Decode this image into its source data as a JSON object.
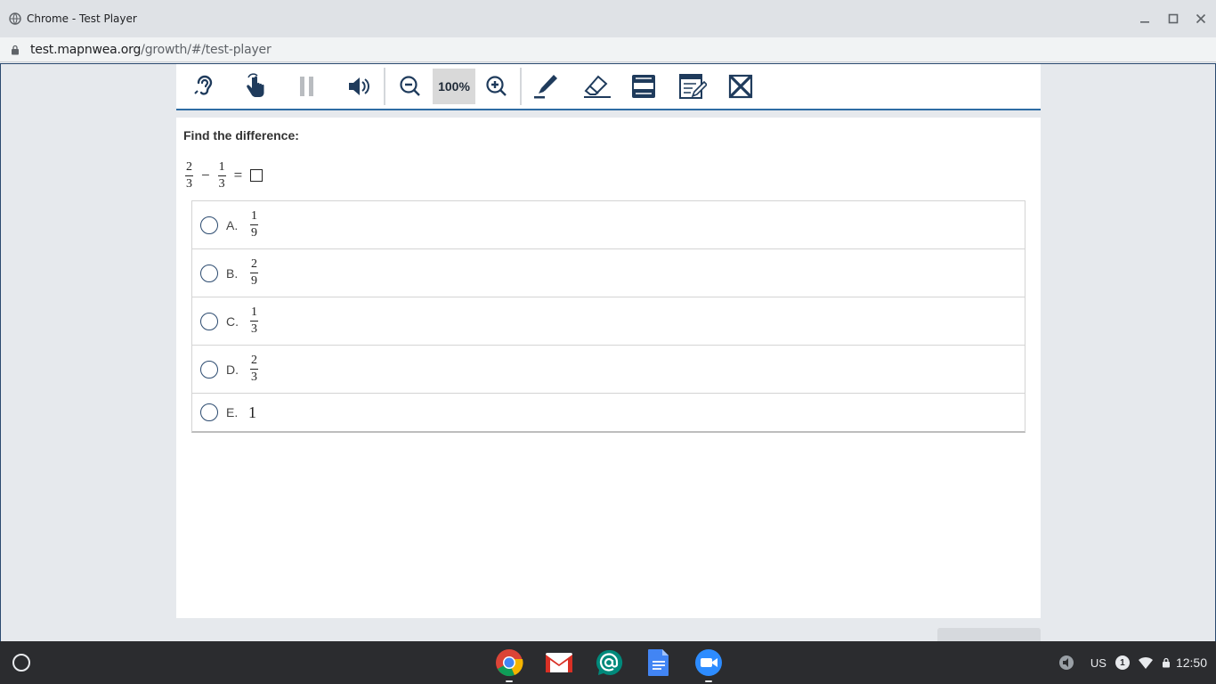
{
  "window": {
    "title": "Chrome - Test Player"
  },
  "address": {
    "host": "test.mapnwea.org",
    "path": "/growth/#/test-player"
  },
  "toolbar": {
    "zoom": "100%"
  },
  "question": {
    "prompt": "Find the difference:",
    "equation": {
      "a_num": "2",
      "a_den": "3",
      "minus": "−",
      "b_num": "1",
      "b_den": "3",
      "equals": "="
    }
  },
  "options": [
    {
      "letter": "A.",
      "num": "1",
      "den": "9"
    },
    {
      "letter": "B.",
      "num": "2",
      "den": "9"
    },
    {
      "letter": "C.",
      "num": "1",
      "den": "3"
    },
    {
      "letter": "D.",
      "num": "2",
      "den": "3"
    },
    {
      "letter": "E.",
      "whole": "1"
    }
  ],
  "shelf": {
    "locale": "US",
    "notifications": "1",
    "time": "12:50"
  },
  "colors": {
    "accent": "#2e6da4",
    "toolbar_icon": "#1f3b5c",
    "shelf_bg": "#2b2c2f"
  },
  "icons": [
    "listen-icon",
    "touch-icon",
    "pause-icon",
    "volume-icon",
    "zoom-out-icon",
    "zoom-in-icon",
    "highlighter-icon",
    "eraser-icon",
    "line-reader-icon",
    "notepad-icon",
    "answer-eliminator-icon"
  ]
}
